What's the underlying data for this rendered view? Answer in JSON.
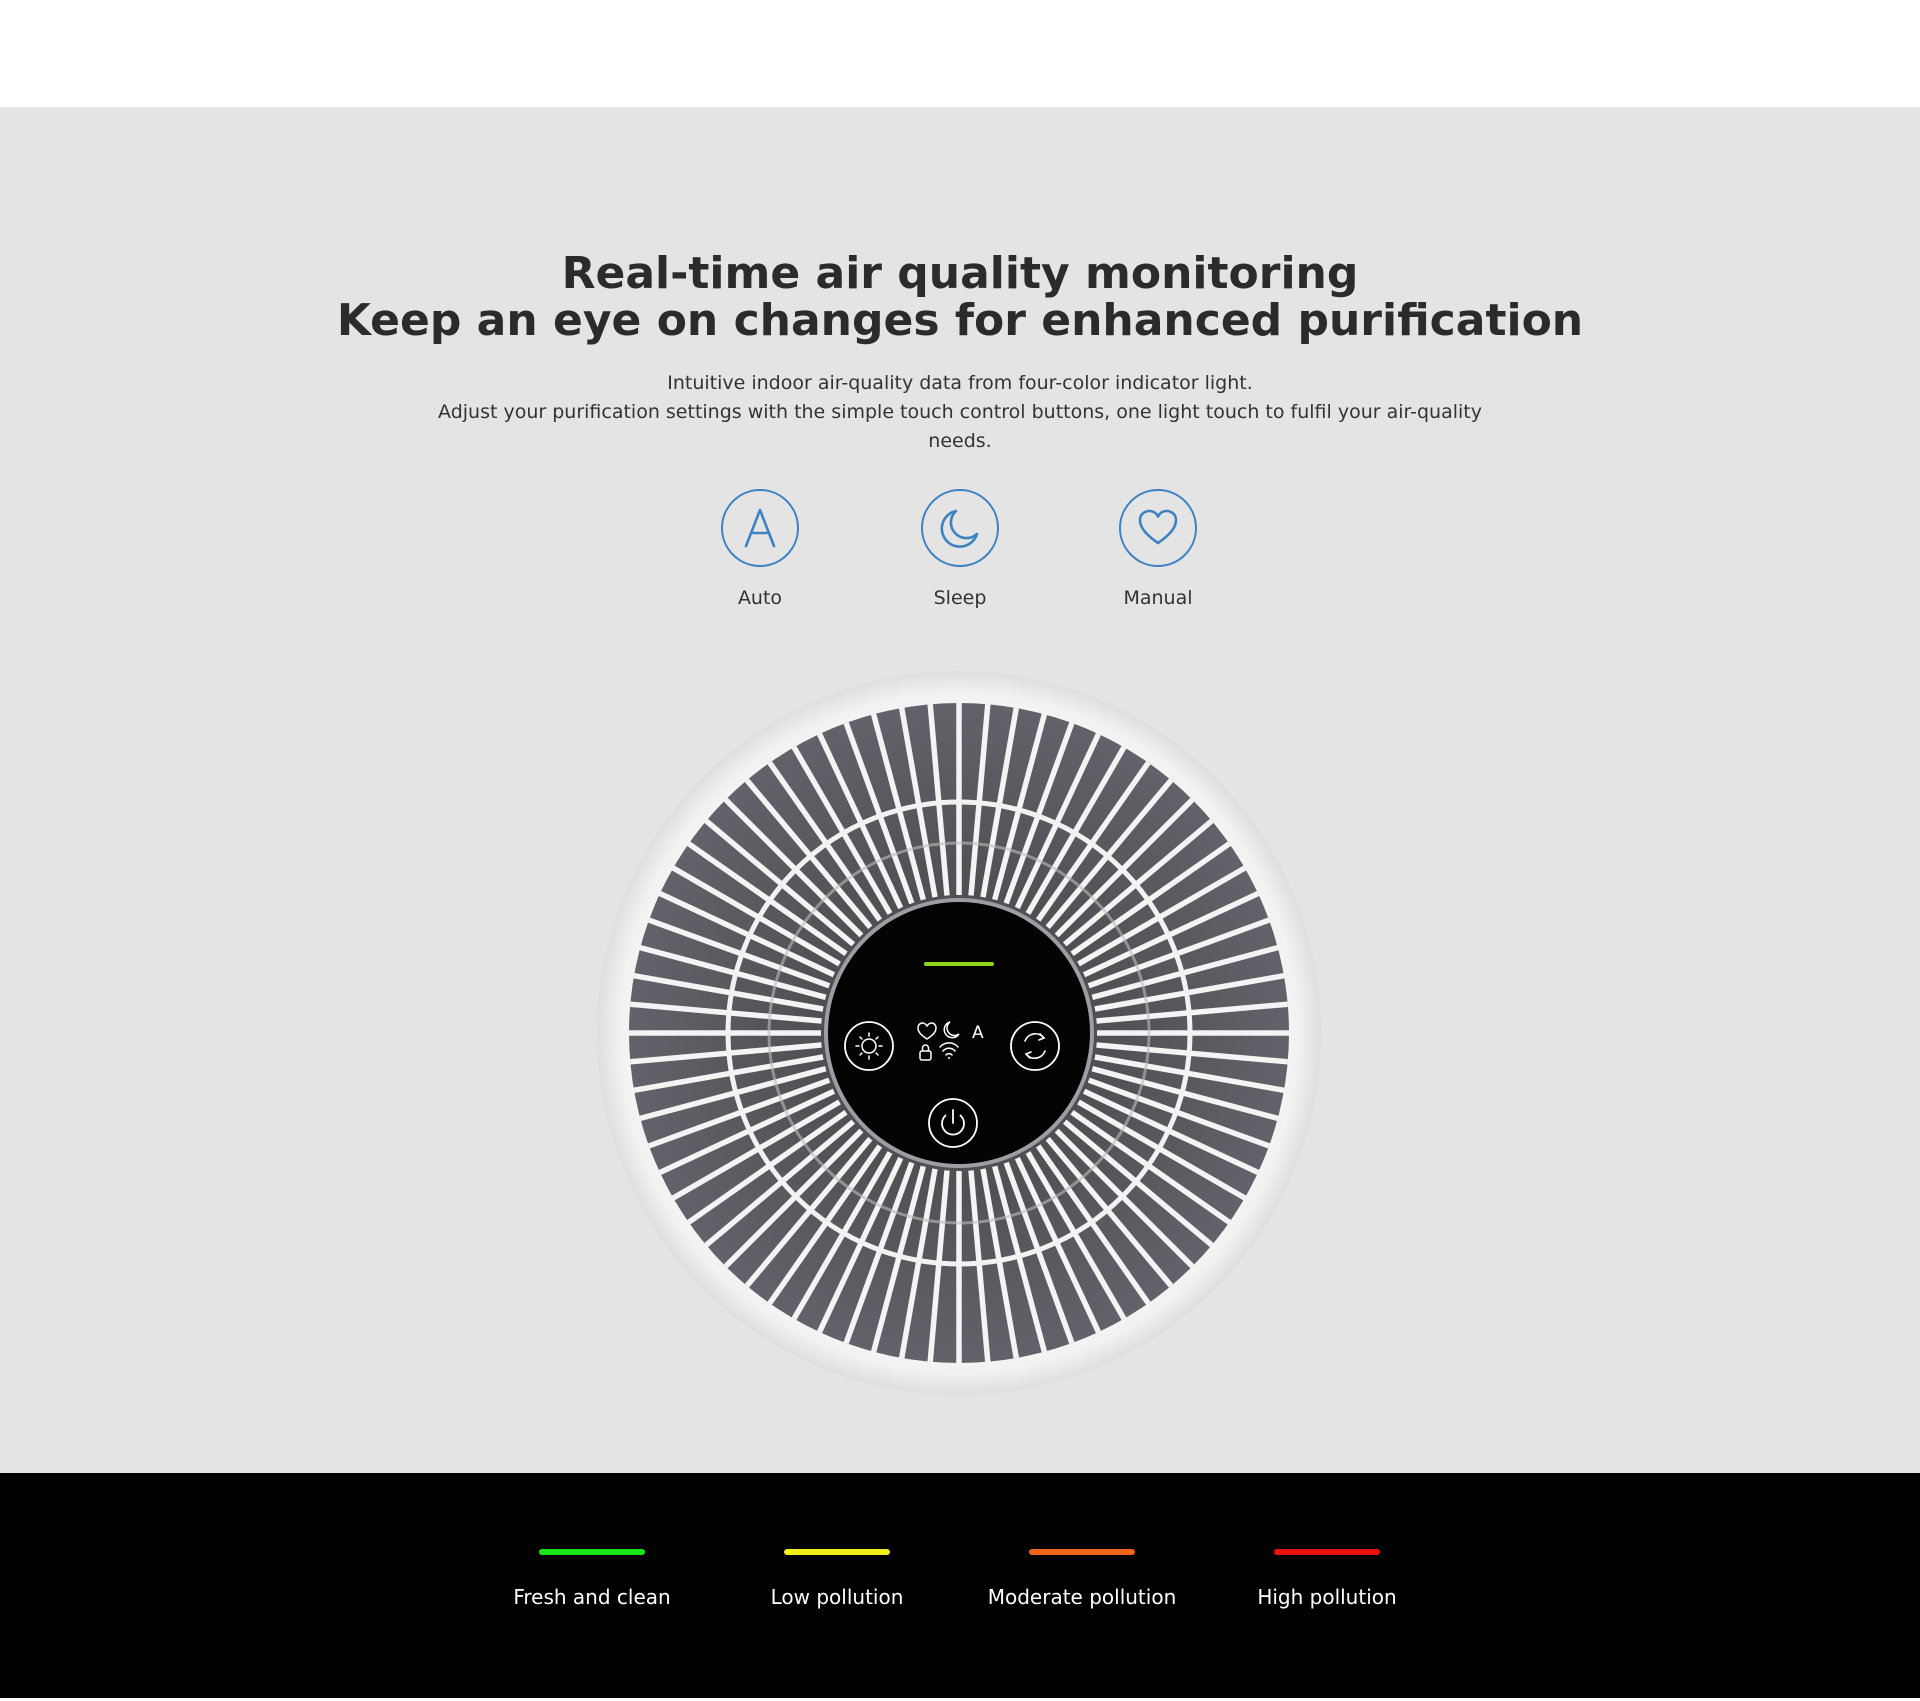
{
  "headline": {
    "line1": "Real-time air quality monitoring",
    "line2": "Keep an eye on changes for enhanced purification"
  },
  "description": {
    "line1": "Intuitive indoor air-quality data from four-color indicator light.",
    "line2": "Adjust your purification settings with the simple touch control buttons, one light touch to fulfil your air-quality",
    "line3": "needs."
  },
  "modes": [
    {
      "label": "Auto",
      "icon": "letter-a-icon"
    },
    {
      "label": "Sleep",
      "icon": "moon-icon"
    },
    {
      "label": "Manual",
      "icon": "heart-icon"
    }
  ],
  "device_panel": {
    "indicator_color": "#8fd61a",
    "mode_glyph": "A"
  },
  "legend": [
    {
      "label": "Fresh and clean",
      "color": "#19e619"
    },
    {
      "label": "Low pollution",
      "color": "#f2ee1a"
    },
    {
      "label": "Moderate pollution",
      "color": "#f06414"
    },
    {
      "label": "High pollution",
      "color": "#e8130f"
    }
  ],
  "colors": {
    "accent": "#3d83c2",
    "hero_background": "#e4e4e4",
    "band_background": "#000000"
  }
}
